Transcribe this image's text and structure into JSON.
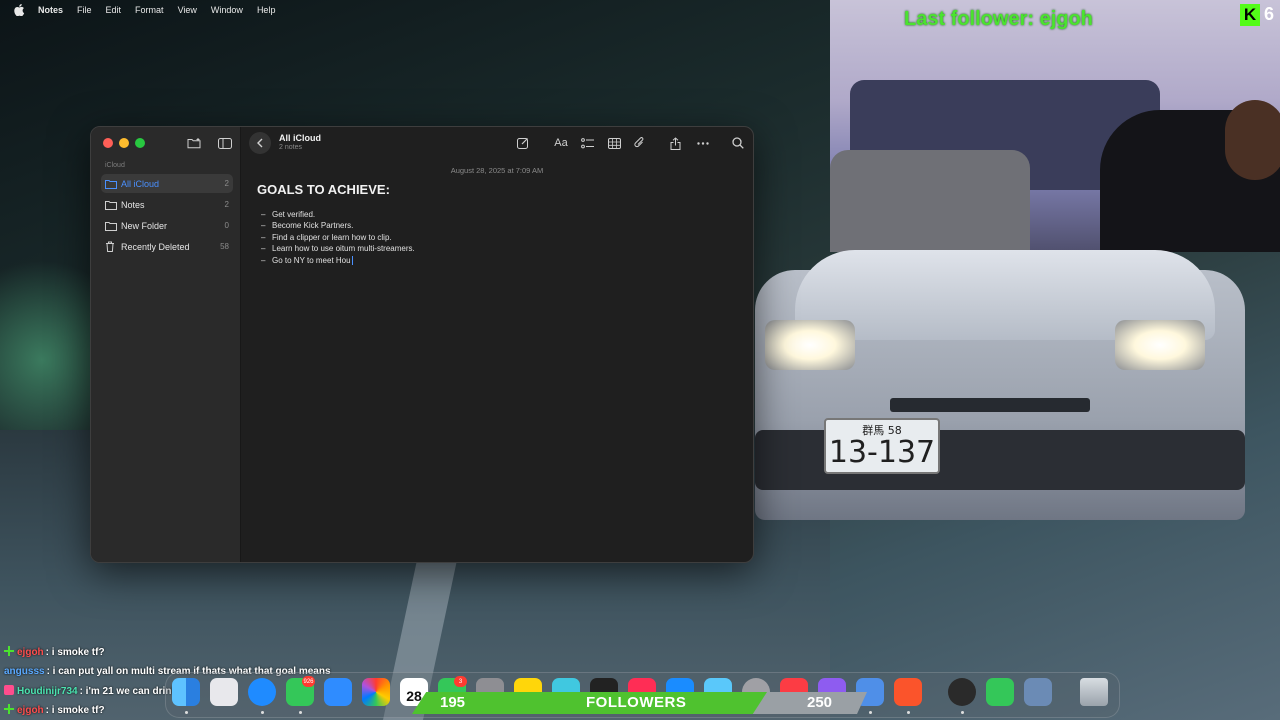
{
  "menubar": {
    "items": [
      "Notes",
      "File",
      "Edit",
      "Format",
      "View",
      "Window",
      "Help"
    ]
  },
  "overlay": {
    "last_follower": "Last follower: ejgoh",
    "kick_count": "6",
    "plate_top": "群馬 58",
    "plate_number": "13-137"
  },
  "notes_window": {
    "sidebar": {
      "section": "iCloud",
      "folders": [
        {
          "label": "All iCloud",
          "count": "2",
          "selected": true
        },
        {
          "label": "Notes",
          "count": "2"
        },
        {
          "label": "New Folder",
          "count": "0"
        },
        {
          "label": "Recently Deleted",
          "count": "58"
        }
      ]
    },
    "toolbar": {
      "title": "All iCloud",
      "subtitle": "2 notes",
      "format_label": "Aa"
    },
    "note": {
      "date": "August 28, 2025 at 7:09 AM",
      "title": "GOALS TO ACHIEVE:",
      "items": [
        "Get verified.",
        "Become Kick Partners.",
        "Find a clipper or learn how to clip.",
        "Learn how to use oitum multi-streamers.",
        "Go to NY to meet Hou"
      ]
    }
  },
  "chat": [
    {
      "user": "ejgoh",
      "text": ": i smoke tf?",
      "color": "#ff4d4d",
      "badge": "#4be32f"
    },
    {
      "user": "angusss",
      "text": ": i can put yall on multi stream if thats what that goal means",
      "color": "#5aa9ff",
      "badge": ""
    },
    {
      "user": "Houdinijr734",
      "text": ": i'm 21 we can drink",
      "color": "#4be3b0",
      "badge": "#ff4d8d"
    },
    {
      "user": "ejgoh",
      "text": ": i smoke tf?",
      "color": "#ff4d4d",
      "badge": "#4be32f"
    }
  ],
  "dock": {
    "calendar_day": "28",
    "messages_badge": "926",
    "mail_badge": "3"
  },
  "follower_goal": {
    "current": "195",
    "label": "FOLLOWERS",
    "goal": "250",
    "progress": 0.78
  },
  "colors": {
    "accent": "#4a90ff",
    "follower_green": "#4fc22f",
    "kick_green": "#53fc18"
  }
}
